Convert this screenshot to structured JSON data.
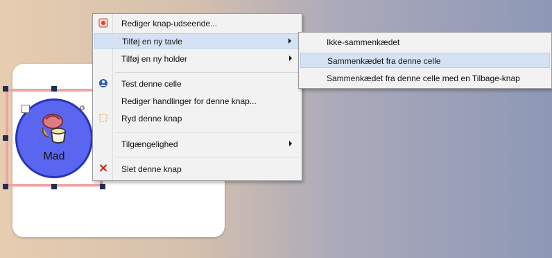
{
  "board": {
    "cell": {
      "label": "Mad",
      "icon": "food-icon"
    }
  },
  "context_menu": {
    "items": [
      {
        "label": "Rediger knap-udseende...",
        "icon": "edit-appearance-icon",
        "submenu": false
      },
      {
        "label": "Tilføj en ny tavle",
        "icon": "",
        "submenu": true,
        "highlighted": true
      },
      {
        "label": "Tilføj en ny holder",
        "icon": "",
        "submenu": true
      },
      {
        "label": "Test denne celle",
        "icon": "test-cell-icon",
        "submenu": false
      },
      {
        "label": "Rediger handlinger for denne knap...",
        "icon": "",
        "submenu": false
      },
      {
        "label": "Ryd denne knap",
        "icon": "clear-icon",
        "submenu": false
      },
      {
        "label": "Tilgængelighed",
        "icon": "",
        "submenu": true
      },
      {
        "label": "Slet denne knap",
        "icon": "delete-x-icon",
        "submenu": false
      }
    ]
  },
  "submenu": {
    "items": [
      {
        "label": "Ikke-sammenkædet"
      },
      {
        "label": "Sammenkædet fra denne celle",
        "highlighted": true
      },
      {
        "label": "Sammenkædet fra denne celle med en Tilbage-knap"
      }
    ]
  },
  "colors": {
    "highlight": "#d5e2f5",
    "selection_border": "#f0a3a3",
    "cell_fill": "#5b66f0",
    "delete_red": "#d0231c"
  }
}
